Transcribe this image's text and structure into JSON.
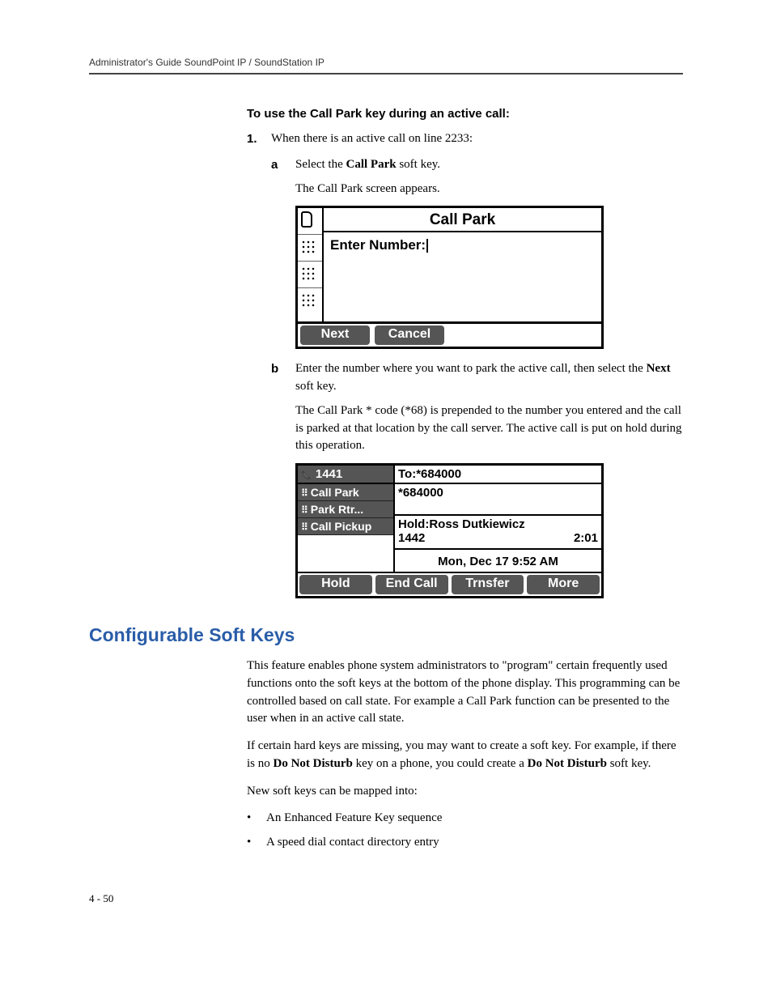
{
  "header": "Administrator's Guide SoundPoint IP / SoundStation IP",
  "proc_title": "To use the Call Park key during an active call:",
  "step1_num": "1.",
  "step1_text": "When there is an active call on line 2233:",
  "step1a_letter": "a",
  "step1a_text_pre": "Select the ",
  "step1a_bold": "Call Park",
  "step1a_text_post": " soft key.",
  "step1a_extra": "The Call Park screen appears.",
  "screen1": {
    "title": "Call Park",
    "prompt": "Enter Number:",
    "softkeys": [
      "Next",
      "Cancel"
    ]
  },
  "step1b_letter": "b",
  "step1b_text_pre": "Enter the number where you want to park the active call, then select the ",
  "step1b_bold": "Next",
  "step1b_text_post": " soft key.",
  "step1b_extra": "The Call Park * code (*68) is prepended to the number you entered and the call is parked at that location by the call server. The active call is put on hold during this operation.",
  "screen2": {
    "topleft": "1441",
    "to_line": "To:*684000",
    "lines": [
      "Call Park",
      "Park Rtr...",
      "Call Pickup"
    ],
    "dialed": "*684000",
    "hold_label": "Hold:Ross Dutkiewicz",
    "hold_ext": "1442",
    "timer": "2:01",
    "datetime": "Mon, Dec 17  9:52 AM",
    "softkeys": [
      "Hold",
      "End Call",
      "Trnsfer",
      "More"
    ]
  },
  "section_title": "Configurable Soft Keys",
  "para1": "This feature enables phone system administrators to \"program\" certain frequently used functions onto the soft keys at the bottom of the phone display. This programming can be controlled based on call state. For example a Call Park function can be presented to the user when in an active call state.",
  "para2_pre": "If certain hard keys are missing, you may want to create a soft key. For example, if there is no ",
  "para2_b1": "Do Not Disturb",
  "para2_mid": " key on a phone, you could create a ",
  "para2_b2": "Do Not Disturb",
  "para2_post": " soft key.",
  "para3": "New soft keys can be mapped into:",
  "bullets": [
    "An Enhanced Feature Key sequence",
    "A speed dial contact directory entry"
  ],
  "page_num": "4 - 50"
}
